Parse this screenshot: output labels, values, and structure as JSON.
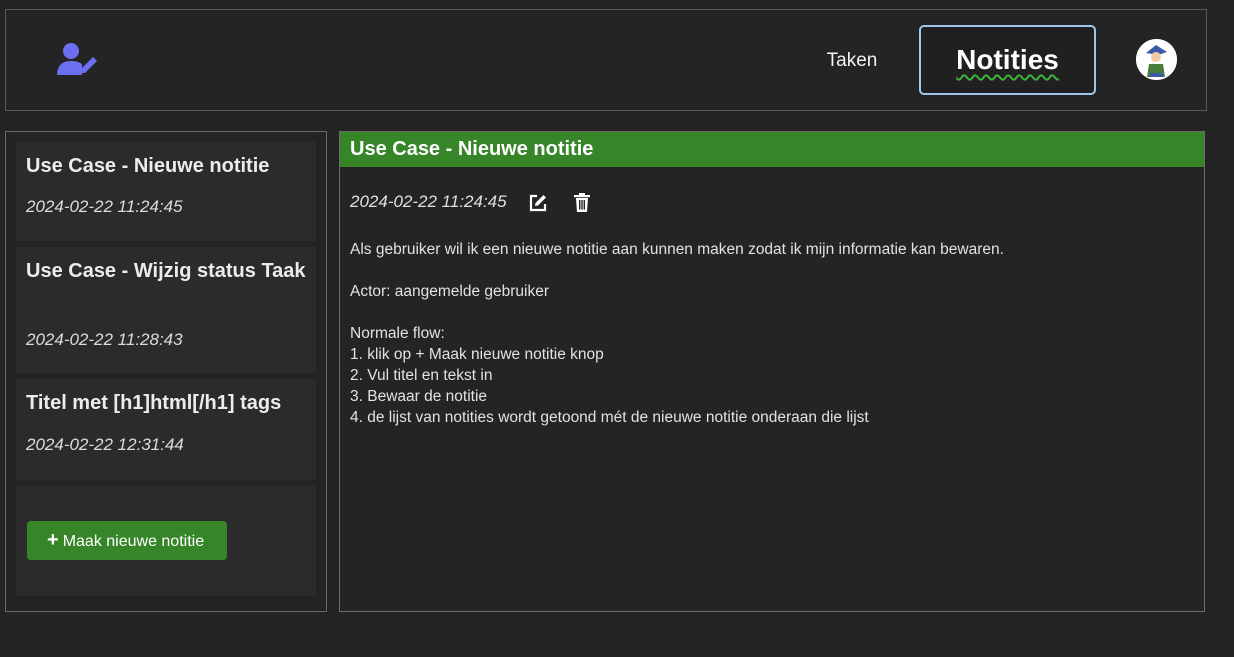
{
  "header": {
    "nav": {
      "taken_label": "Taken",
      "notities_label": "Notities",
      "active": "Notities"
    },
    "icons": {
      "user_icon": "user-edit-icon",
      "avatar": "avatar"
    }
  },
  "notes": [
    {
      "title": "Use Case - Nieuwe notitie",
      "date": "2024-02-22 11:24:45"
    },
    {
      "title": "Use Case - Wijzig status Taak",
      "date": "2024-02-22 11:28:43"
    },
    {
      "title": "Titel met [h1]html[/h1] tags",
      "date": "2024-02-22 12:31:44"
    }
  ],
  "new_note_button": {
    "label": "Maak nieuwe notitie",
    "icon": "plus-icon"
  },
  "detail": {
    "title": "Use Case - Nieuwe notitie",
    "date": "2024-02-22 11:24:45",
    "intro": "Als gebruiker wil ik een nieuwe notitie aan kunnen maken zodat ik mijn informatie kan bewaren.",
    "actor": "Actor: aangemelde gebruiker",
    "flow_heading": "Normale flow:",
    "flow_steps": [
      "1. klik op + Maak nieuwe notitie knop",
      "2. Vul titel en tekst in",
      "3. Bewaar de notitie",
      "4. de lijst van notities wordt getoond mét de nieuwe notitie onderaan die lijst"
    ]
  },
  "colors": {
    "accent_green": "#368528",
    "active_tab_border": "#9fc7ee",
    "icon_blue": "#6c6ff0",
    "background": "#232323"
  }
}
